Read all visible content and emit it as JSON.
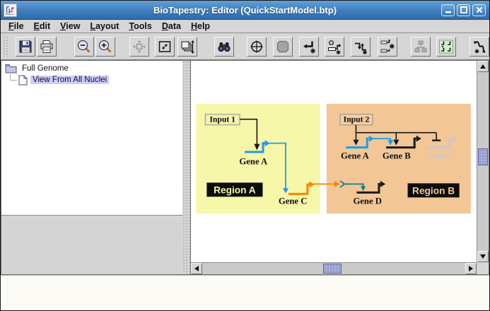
{
  "window": {
    "title": "BioTapestry: Editor (QuickStartModel.btp)"
  },
  "menu_bar": {
    "items": [
      {
        "label": "File"
      },
      {
        "label": "Edit"
      },
      {
        "label": "View"
      },
      {
        "label": "Layout"
      },
      {
        "label": "Tools"
      },
      {
        "label": "Data"
      },
      {
        "label": "Help"
      }
    ]
  },
  "toolbar": {
    "buttons": [
      {
        "icon": "save-icon",
        "enabled": true
      },
      {
        "icon": "print-icon",
        "enabled": true
      },
      {
        "icon": "zoom-out-icon",
        "enabled": true
      },
      {
        "icon": "zoom-in-icon",
        "enabled": true
      },
      {
        "icon": "zoom-to-selected-icon",
        "enabled": false
      },
      {
        "icon": "zoom-to-model-icon",
        "enabled": true
      },
      {
        "icon": "zoom-to-all-models-icon",
        "enabled": true
      },
      {
        "icon": "search-icon",
        "enabled": true
      },
      {
        "icon": "center-on-icon",
        "enabled": true
      },
      {
        "icon": "cancel-add-icon",
        "enabled": false
      },
      {
        "icon": "add-link-icon",
        "enabled": true
      },
      {
        "icon": "add-gene-icon",
        "enabled": true
      },
      {
        "icon": "add-node-icon",
        "enabled": true
      },
      {
        "icon": "add-region-icon",
        "enabled": true
      },
      {
        "icon": "model-hierarchy-icon",
        "enabled": false
      },
      {
        "icon": "sync-layout-icon",
        "enabled": true
      },
      {
        "icon": "draw-link-icon",
        "enabled": true
      }
    ]
  },
  "model_tree": {
    "items": [
      {
        "label": "Full Genome",
        "icon": "folder-icon",
        "selected": false
      },
      {
        "label": "View From All Nuclei",
        "icon": "document-icon",
        "selected": true
      }
    ]
  },
  "diagram": {
    "regions": [
      {
        "label": "Region A",
        "fill": "#f6f7a8"
      },
      {
        "label": "Region B",
        "fill": "#f2c795"
      }
    ],
    "inputs": [
      {
        "label": "Input 1"
      },
      {
        "label": "Input 2"
      }
    ],
    "genes": [
      {
        "label": "Gene A",
        "region": "A",
        "color": "#1e9ceb"
      },
      {
        "label": "Gene C",
        "region": "A",
        "color": "#ff8200"
      },
      {
        "label": "Gene A",
        "region": "B",
        "color": "#1e9ceb"
      },
      {
        "label": "Gene B",
        "region": "B",
        "color": "#1a1a1a"
      },
      {
        "label": "Gene C",
        "region": "B",
        "color": "#c9c9c9",
        "inactive": true
      },
      {
        "label": "Gene D",
        "region": "B",
        "color": "#1a1a1a"
      }
    ],
    "link_colors": {
      "black": "#1a1a1a",
      "blue": "#1e9ceb",
      "orange": "#ff8200",
      "teal": "#0b7f92"
    }
  },
  "colors": {
    "title_bar": "#3f7cba",
    "selection": "#ccccff",
    "scrollbar_thumb": "#a6acd8",
    "inactive_gray": "#c9c9c9"
  }
}
